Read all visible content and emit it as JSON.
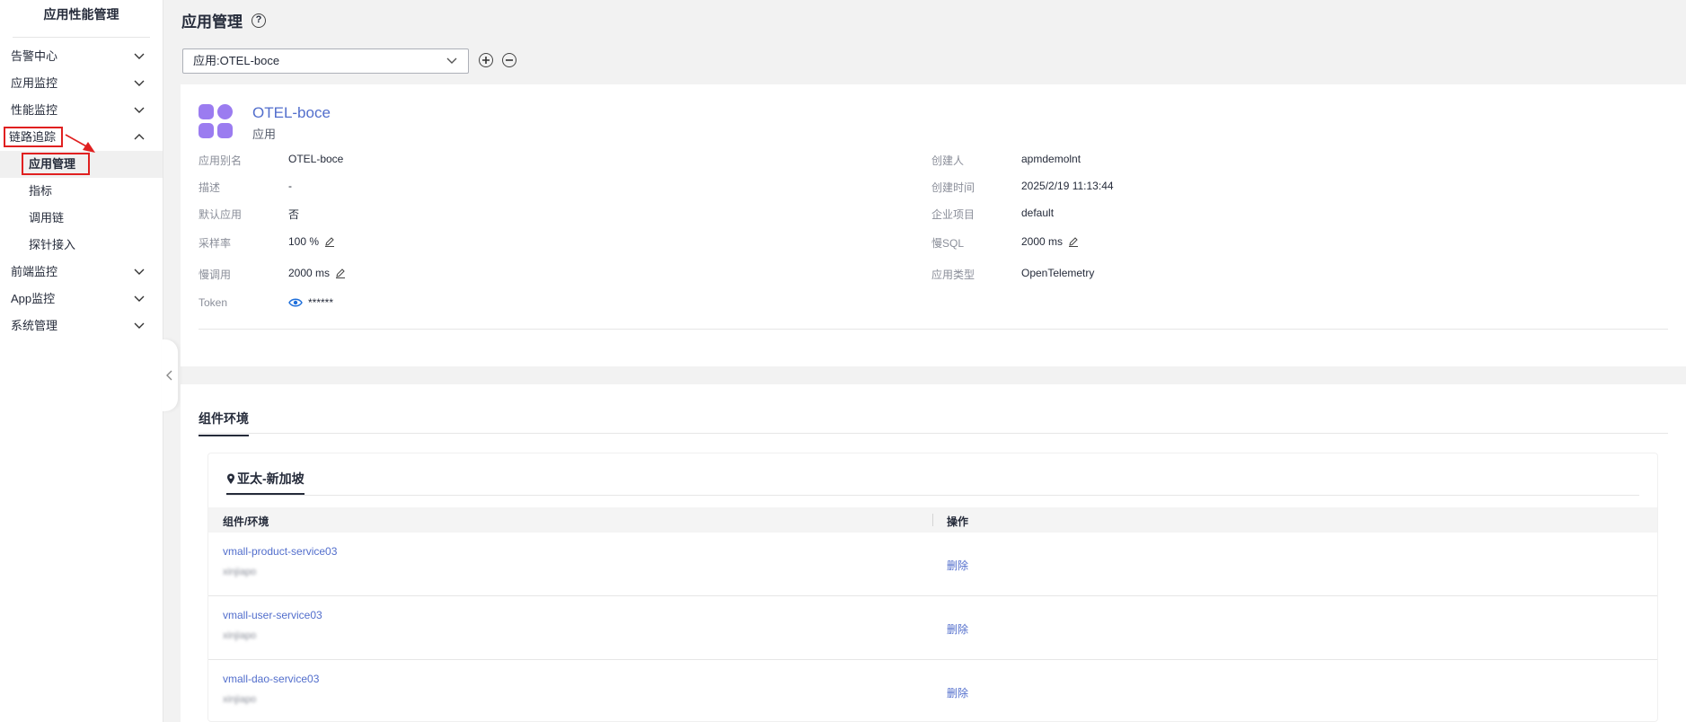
{
  "sidebar": {
    "title": "应用性能管理",
    "items": [
      {
        "label": "告警中心"
      },
      {
        "label": "应用监控"
      },
      {
        "label": "性能监控"
      },
      {
        "label": "链路追踪"
      },
      {
        "label": "前端监控"
      },
      {
        "label": "App监控"
      },
      {
        "label": "系统管理"
      }
    ],
    "sub_items": [
      {
        "label": "应用管理"
      },
      {
        "label": "指标"
      },
      {
        "label": "调用链"
      },
      {
        "label": "探针接入"
      }
    ]
  },
  "page": {
    "title": "应用管理",
    "help_icon": "?",
    "select_value": "应用:OTEL-boce"
  },
  "app": {
    "name": "OTEL-boce",
    "type": "应用",
    "left_fields": [
      {
        "label": "应用别名",
        "value": "OTEL-boce"
      },
      {
        "label": "描述",
        "value": "-"
      },
      {
        "label": "默认应用",
        "value": "否"
      },
      {
        "label": "采样率",
        "value": "100 %"
      },
      {
        "label": "慢调用",
        "value": "2000 ms"
      },
      {
        "label": "Token",
        "value": "******"
      }
    ],
    "right_fields": [
      {
        "label": "创建人",
        "value": "apmdemolnt"
      },
      {
        "label": "创建时间",
        "value": "2025/2/19 11:13:44"
      },
      {
        "label": "企业项目",
        "value": "default"
      },
      {
        "label": "慢SQL",
        "value": "2000 ms"
      },
      {
        "label": "应用类型",
        "value": "OpenTelemetry"
      }
    ]
  },
  "components": {
    "tab": "组件环境",
    "region": "亚太-新加坡",
    "columns": [
      "组件/环境",
      "操作"
    ],
    "rows": [
      {
        "service": "vmall-product-service03",
        "env": "xinjiapo",
        "action": "删除"
      },
      {
        "service": "vmall-user-service03",
        "env": "xinjiapo",
        "action": "删除"
      },
      {
        "service": "vmall-dao-service03",
        "env": "xinjiapo",
        "action": "删除"
      }
    ]
  },
  "colors": {
    "link": "#526ecc",
    "highlight": "#e02020",
    "icon": "#9b7cf0"
  }
}
